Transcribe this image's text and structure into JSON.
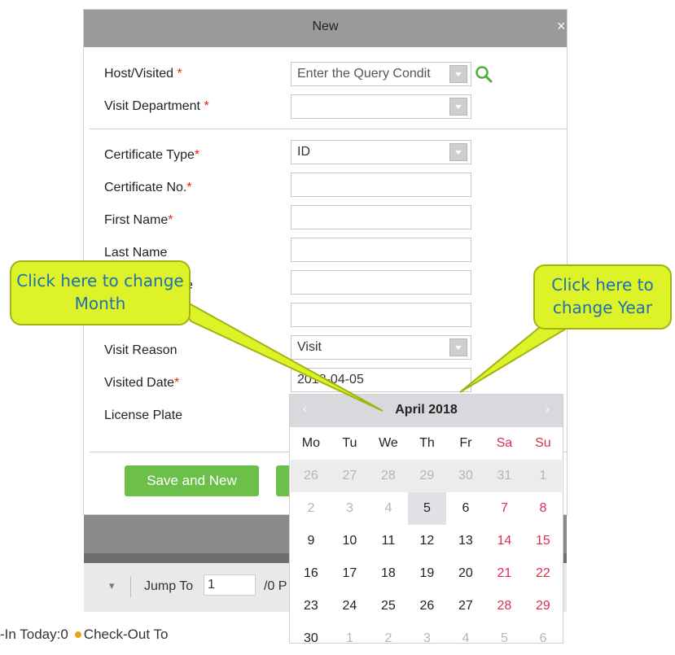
{
  "dialog": {
    "title": "New",
    "close_glyph": "×",
    "fields": [
      {
        "label": "Host/Visited",
        "required": "*",
        "value": "",
        "placeholder": "Enter the Query Condit"
      },
      {
        "label": "Visit Department",
        "required": "*",
        "value": ""
      },
      {
        "label": "Certificate Type",
        "required": "*",
        "value": "ID"
      },
      {
        "label": "Certificate No.",
        "required": "*",
        "value": ""
      },
      {
        "label": "First Name",
        "required": "*",
        "value": ""
      },
      {
        "label": "Last Name",
        "required": "",
        "value": ""
      },
      {
        "label": "e",
        "required": "",
        "value": ""
      },
      {
        "label": "",
        "required": "",
        "value": ""
      },
      {
        "label": "Visit Reason",
        "required": "",
        "value": "Visit"
      },
      {
        "label": "Visited Date",
        "required": "*",
        "value": "2018-04-05"
      },
      {
        "label": "License Plate",
        "required": "",
        "value": ""
      }
    ],
    "buttons": {
      "save_and_new": "Save and New"
    },
    "icons": {
      "search": "search-icon",
      "dropdown": "chevron-down-icon"
    }
  },
  "calendar": {
    "title": "April 2018",
    "prev_glyph": "‹",
    "next_glyph": "›",
    "weekdays": [
      "Mo",
      "Tu",
      "We",
      "Th",
      "Fr",
      "Sa",
      "Su"
    ],
    "weeks": [
      [
        "26",
        "27",
        "28",
        "29",
        "30",
        "31",
        "1"
      ],
      [
        "2",
        "3",
        "4",
        "5",
        "6",
        "7",
        "8"
      ],
      [
        "9",
        "10",
        "11",
        "12",
        "13",
        "14",
        "15"
      ],
      [
        "16",
        "17",
        "18",
        "19",
        "20",
        "21",
        "22"
      ],
      [
        "23",
        "24",
        "25",
        "26",
        "27",
        "28",
        "29"
      ],
      [
        "30",
        "1",
        "2",
        "3",
        "4",
        "5",
        "6"
      ]
    ],
    "selected_day": "5",
    "weekend_color": "#d9304f"
  },
  "callouts": {
    "month": "Click here to change Month",
    "year": "Click here to change Year"
  },
  "pager": {
    "arrow": "▾",
    "jump_label": "Jump To",
    "jump_value": "1",
    "total": "/0 P"
  },
  "footer": {
    "checkin": "-In Today:0",
    "checkout": "Check-Out To"
  },
  "colors": {
    "accent_green": "#6cc04a",
    "callout": "#ddf227",
    "callout_text": "#1f6fb2"
  }
}
